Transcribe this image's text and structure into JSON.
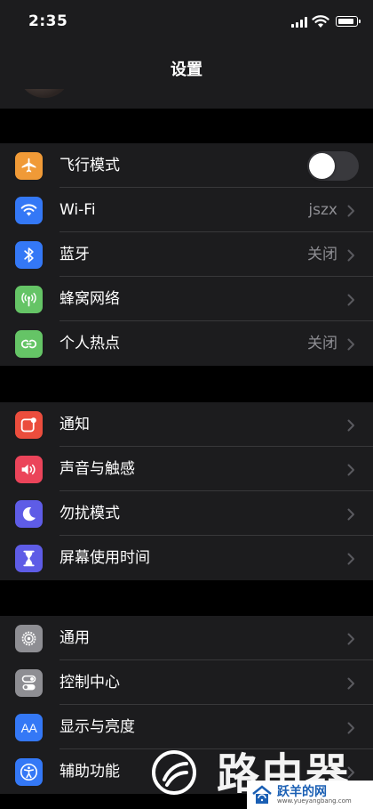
{
  "status_bar": {
    "time": "2:35",
    "battery_level": 0.9
  },
  "nav": {
    "title": "设置"
  },
  "groups": [
    [
      {
        "label": "飞行模式",
        "icon": "airplane-icon",
        "color": "#f09a37",
        "toggle": false
      },
      {
        "label": "Wi-Fi",
        "icon": "wifi-icon",
        "color": "#3478f6",
        "value": "jszx"
      },
      {
        "label": "蓝牙",
        "icon": "bluetooth-icon",
        "color": "#3478f6",
        "value": "关闭"
      },
      {
        "label": "蜂窝网络",
        "icon": "cellular-icon",
        "color": "#65c466"
      },
      {
        "label": "个人热点",
        "icon": "hotspot-icon",
        "color": "#65c466",
        "value": "关闭"
      }
    ],
    [
      {
        "label": "通知",
        "icon": "notification-icon",
        "color": "#eb4d3d"
      },
      {
        "label": "声音与触感",
        "icon": "speaker-icon",
        "color": "#eb445a"
      },
      {
        "label": "勿扰模式",
        "icon": "moon-icon",
        "color": "#5e5ce6"
      },
      {
        "label": "屏幕使用时间",
        "icon": "hourglass-icon",
        "color": "#5e5ce6"
      }
    ],
    [
      {
        "label": "通用",
        "icon": "gear-icon",
        "color": "#8e8e93"
      },
      {
        "label": "控制中心",
        "icon": "switches-icon",
        "color": "#8e8e93"
      },
      {
        "label": "显示与亮度",
        "icon": "text-size-icon",
        "color": "#3478f6",
        "icon_text": "AA"
      },
      {
        "label": "辅助功能",
        "icon": "accessibility-icon",
        "color": "#3478f6"
      }
    ]
  ],
  "watermark": {
    "text": "路由器",
    "site_name": "跃羊的网",
    "site_url": "www.yueyangbang.com"
  }
}
